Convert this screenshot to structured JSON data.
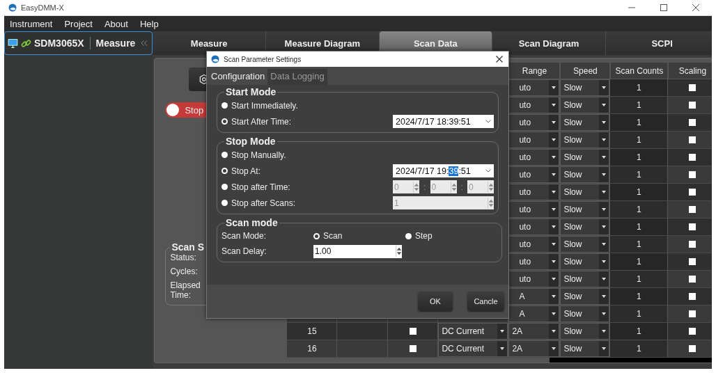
{
  "window": {
    "title": "EasyDMM-X"
  },
  "menu": [
    "Instrument",
    "Project",
    "About",
    "Help"
  ],
  "sidebar": {
    "instrument": "SDM3065X",
    "mode": "Measure"
  },
  "tabs": [
    {
      "label": "Measure",
      "selected": false
    },
    {
      "label": "Measure Diagram",
      "selected": false
    },
    {
      "label": "Scan Data",
      "selected": true
    },
    {
      "label": "Scan Diagram",
      "selected": false
    },
    {
      "label": "SCPI",
      "selected": false
    }
  ],
  "controls": {
    "toggle": {
      "label": "Stop",
      "on": false
    },
    "scan_status": {
      "title": "Scan S",
      "labels": [
        "Status:",
        "Cycles:",
        "Elapsed Time:"
      ]
    }
  },
  "table": {
    "columns": [
      "Range",
      "Speed",
      "Scan Counts",
      "Scaling"
    ],
    "rows": [
      {
        "range": "uto",
        "speed": "Slow",
        "scan_counts": "1",
        "scaling": false
      },
      {
        "range": "uto",
        "speed": "Slow",
        "scan_counts": "1",
        "scaling": false
      },
      {
        "range": "uto",
        "speed": "Slow",
        "scan_counts": "1",
        "scaling": false
      },
      {
        "range": "uto",
        "speed": "Slow",
        "scan_counts": "1",
        "scaling": false
      },
      {
        "range": "uto",
        "speed": "Slow",
        "scan_counts": "1",
        "scaling": false
      },
      {
        "range": "uto",
        "speed": "Slow",
        "scan_counts": "1",
        "scaling": false
      },
      {
        "range": "uto",
        "speed": "Slow",
        "scan_counts": "1",
        "scaling": false
      },
      {
        "range": "uto",
        "speed": "Slow",
        "scan_counts": "1",
        "scaling": false
      },
      {
        "range": "uto",
        "speed": "Slow",
        "scan_counts": "1",
        "scaling": false
      },
      {
        "range": "uto",
        "speed": "Slow",
        "scan_counts": "1",
        "scaling": false
      },
      {
        "range": "uto",
        "speed": "Slow",
        "scan_counts": "1",
        "scaling": false
      },
      {
        "range": "uto",
        "speed": "Slow",
        "scan_counts": "1",
        "scaling": false
      },
      {
        "range": "A",
        "speed": "Slow",
        "scan_counts": "1",
        "scaling": false
      },
      {
        "range": "A",
        "speed": "Slow",
        "scan_counts": "1",
        "scaling": false
      },
      {
        "number": "15",
        "checked": false,
        "function": "DC Current",
        "range": "2A",
        "speed": "Slow",
        "scan_counts": "1",
        "scaling": false
      },
      {
        "number": "16",
        "checked": false,
        "function": "DC Current",
        "range": "2A",
        "speed": "Slow",
        "scan_counts": "1",
        "scaling": false
      }
    ]
  },
  "dialog": {
    "title": "Scan Parameter Settings",
    "tabs": [
      {
        "label": "Configuration",
        "selected": true
      },
      {
        "label": "Data Logging",
        "selected": false
      }
    ],
    "start_mode": {
      "title": "Start Mode",
      "options": [
        {
          "label": "Start Immediately.",
          "selected": false
        },
        {
          "label": "Start After Time:",
          "selected": true,
          "kind": "datetime",
          "value_parts": [
            {
              "text": "2024/7/17 18:39:51",
              "selected": false
            }
          ]
        }
      ]
    },
    "stop_mode": {
      "title": "Stop Mode",
      "options": [
        {
          "label": "Stop Manually.",
          "selected": false
        },
        {
          "label": "Stop At:",
          "selected": true,
          "kind": "datetime",
          "value_parts": [
            {
              "text": "2024/7/17 19:",
              "selected": false
            },
            {
              "text": "39",
              "selected": true
            },
            {
              "text": ":51",
              "selected": false
            }
          ]
        },
        {
          "label": "Stop after Time:",
          "selected": false,
          "kind": "duration",
          "values": [
            "0",
            "0",
            "0"
          ],
          "separators": [
            ":",
            ":"
          ],
          "disabled": true
        },
        {
          "label": "Stop after Scans:",
          "selected": false,
          "kind": "count",
          "value": "1",
          "disabled": true
        }
      ]
    },
    "scan_mode": {
      "title": "Scan mode",
      "mode_label": "Scan Mode:",
      "modes": [
        {
          "label": "Scan",
          "selected": true
        },
        {
          "label": "Step",
          "selected": false
        }
      ],
      "delay_label": "Scan Delay:",
      "delay": "1.00"
    },
    "buttons": [
      "OK",
      "Cancle"
    ]
  }
}
